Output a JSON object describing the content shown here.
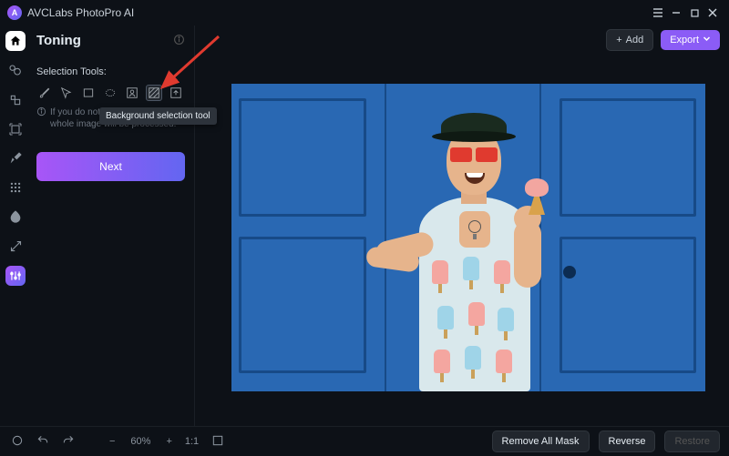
{
  "titlebar": {
    "app_name": "AVCLabs PhotoPro AI"
  },
  "toprow": {
    "add_label": "Add",
    "export_label": "Export"
  },
  "panel": {
    "title": "Toning",
    "section_label": "Selection Tools:",
    "hint_text": "If you do not select an area, the whole image will be processed.",
    "next_label": "Next",
    "tooltip": "Background selection tool"
  },
  "tools": {
    "brush": "brush",
    "lasso": "lasso",
    "rect": "rectangle",
    "ellipse": "ellipse",
    "subject": "subject",
    "bg": "background",
    "import": "import-mask"
  },
  "rail": {
    "home": "home",
    "layers": "layers",
    "crop": "crop",
    "expand": "expand",
    "retouch": "retouch",
    "blur": "blur",
    "color": "colorize",
    "resize": "resize",
    "toning": "toning"
  },
  "bottombar": {
    "zoom_value": "60%",
    "fit_label": "1:1",
    "remove_mask_label": "Remove All Mask",
    "reverse_label": "Reverse",
    "restore_label": "Restore"
  }
}
